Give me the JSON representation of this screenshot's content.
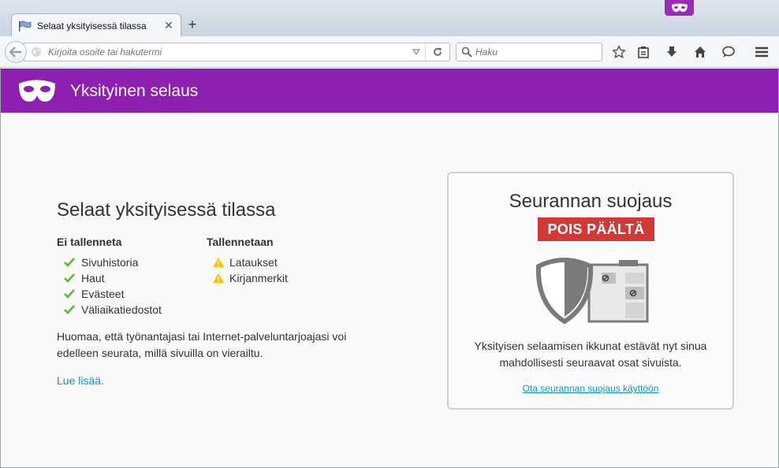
{
  "browser": {
    "tab": {
      "title": "Selaat yksityisessä tilassa",
      "close": "✕"
    },
    "new_tab": "+",
    "url_placeholder": "Kirjoita osoite tai hakutermi",
    "search_placeholder": "Haku"
  },
  "header": {
    "title": "Yksityinen selaus"
  },
  "main": {
    "title": "Selaat yksityisessä tilassa",
    "not_saved": {
      "heading": "Ei tallenneta",
      "items": [
        "Sivuhistoria",
        "Haut",
        "Evästeet",
        "Väliaikatiedostot"
      ]
    },
    "saved": {
      "heading": "Tallennetaan",
      "items": [
        "Lataukset",
        "Kirjanmerkit"
      ]
    },
    "note": "Huomaa, että työnantajasi tai Internet-palveluntarjoajasi voi edelleen seurata, millä sivuilla on vierailtu.",
    "learn_more": "Lue lisää."
  },
  "tracking": {
    "title": "Seurannan suojaus",
    "status": "POIS PÄÄLTÄ",
    "description": "Yksityisen selaamisen ikkunat estävät nyt sinua mahdollisesti seuraavat osat sivuista.",
    "enable_link": "Ota seurannan suojaus käyttöön"
  },
  "colors": {
    "accent": "#8d20b1",
    "status_off": "#d33934",
    "link": "#0a96c8",
    "check": "#57bd35",
    "warn": "#ffbf00"
  },
  "icons": [
    "private-mask-icon",
    "back-arrow-icon",
    "globe-icon",
    "dropdown-arrow-icon",
    "reload-icon",
    "search-icon",
    "bookmark-star-icon",
    "reading-list-icon",
    "download-icon",
    "home-icon",
    "chat-icon",
    "menu-icon",
    "check-icon",
    "warning-icon",
    "shield-icon"
  ]
}
